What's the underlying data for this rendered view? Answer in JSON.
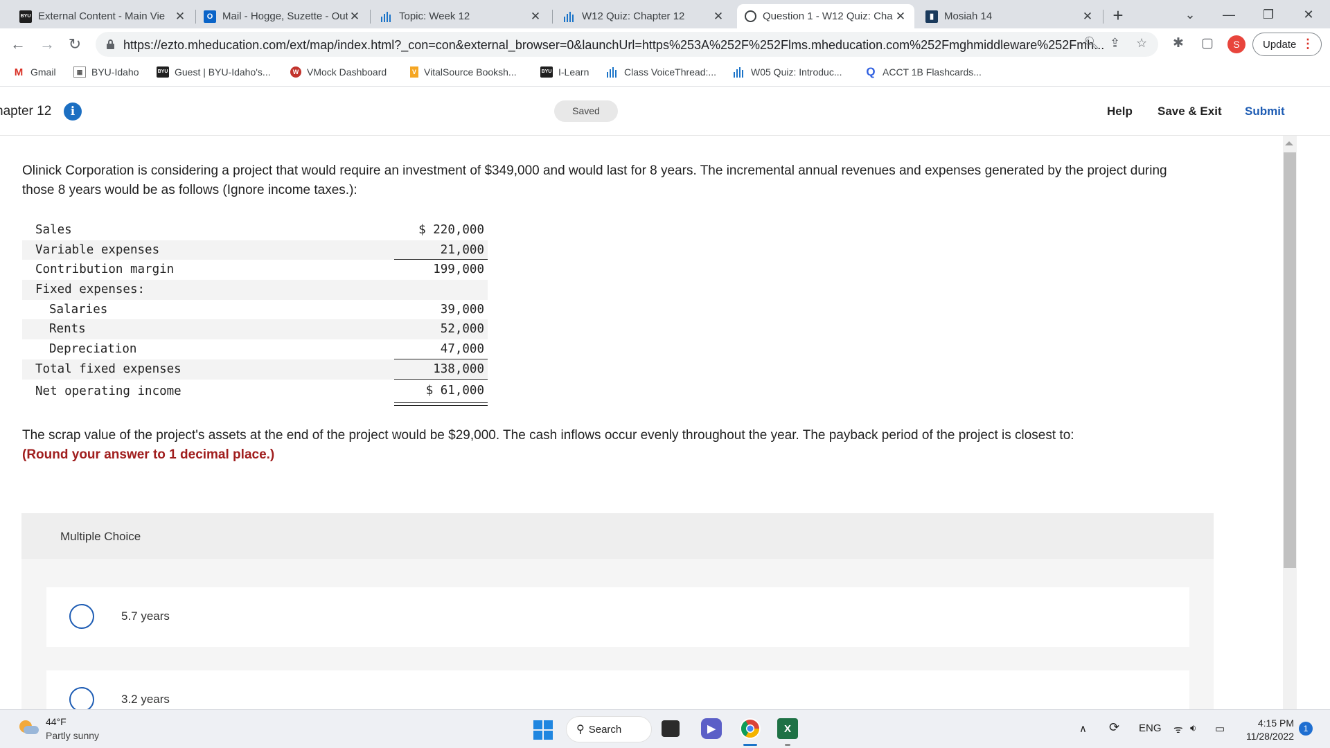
{
  "browser": {
    "tabs": [
      {
        "title": "External Content - Main Vie",
        "icon": "byu-idaho-icon",
        "active": false
      },
      {
        "title": "Mail - Hogge, Suzette - Out",
        "icon": "outlook-icon",
        "active": false
      },
      {
        "title": "Topic: Week 12",
        "icon": "d2l-bars-icon",
        "active": false
      },
      {
        "title": "W12 Quiz: Chapter 12",
        "icon": "d2l-bars-icon",
        "active": false
      },
      {
        "title": "Question 1 - W12 Quiz: Cha",
        "icon": "globe-icon",
        "active": true
      },
      {
        "title": "Mosiah 14",
        "icon": "book-icon",
        "active": false
      }
    ],
    "url": "https://ezto.mheducation.com/ext/map/index.html?_con=con&external_browser=0&launchUrl=https%253A%252F%252Flms.mheducation.com%252Fmghmiddleware%252Fmh...",
    "profile_initial": "S",
    "update_label": "Update",
    "bookmarks": [
      {
        "label": "Gmail",
        "icon": "gmail-icon"
      },
      {
        "label": "BYU-Idaho",
        "icon": "byu-idaho-icon"
      },
      {
        "label": "Guest | BYU-Idaho's...",
        "icon": "byu-idaho-icon"
      },
      {
        "label": "VMock Dashboard",
        "icon": "vmock-icon"
      },
      {
        "label": "VitalSource Booksh...",
        "icon": "vitalsource-icon"
      },
      {
        "label": "I-Learn",
        "icon": "byu-idaho-icon"
      },
      {
        "label": "Class VoiceThread:...",
        "icon": "d2l-bars-icon"
      },
      {
        "label": "W05 Quiz: Introduc...",
        "icon": "d2l-bars-icon"
      },
      {
        "label": "ACCT 1B Flashcards...",
        "icon": "quizlet-icon"
      }
    ]
  },
  "header": {
    "chapter_title": "hapter 12",
    "saved_label": "Saved",
    "help_label": "Help",
    "save_exit_label": "Save & Exit",
    "submit_label": "Submit"
  },
  "question": {
    "intro": "Olinick Corporation is considering a project that would require an investment of $349,000 and would last for 8 years. The incremental annual revenues and expenses generated by the project during those 8 years would be as follows (Ignore income taxes.):",
    "rows": [
      {
        "label": "Sales",
        "value": "$ 220,000"
      },
      {
        "label": "Variable expenses",
        "value": "21,000"
      },
      {
        "label": "Contribution margin",
        "value": "199,000"
      },
      {
        "label": "Fixed expenses:",
        "value": ""
      },
      {
        "label": "Salaries",
        "value": "39,000"
      },
      {
        "label": "Rents",
        "value": "52,000"
      },
      {
        "label": "Depreciation",
        "value": "47,000"
      },
      {
        "label": "Total fixed expenses",
        "value": "138,000"
      },
      {
        "label": "Net operating income",
        "value": "$ 61,000"
      }
    ],
    "followup": "The scrap value of the project's assets at the end of the project would be $29,000. The cash inflows occur evenly throughout the year. The payback period of the project is closest to:",
    "instruction": "(Round your answer to 1 decimal place.)"
  },
  "multiple_choice": {
    "title": "Multiple Choice",
    "choices": [
      "5.7 years",
      "3.2 years"
    ]
  },
  "taskbar": {
    "temperature": "44°F",
    "weather": "Partly sunny",
    "search_label": "Search",
    "language": "ENG",
    "time": "4:15 PM",
    "date": "11/28/2022",
    "notification_count": "1"
  }
}
